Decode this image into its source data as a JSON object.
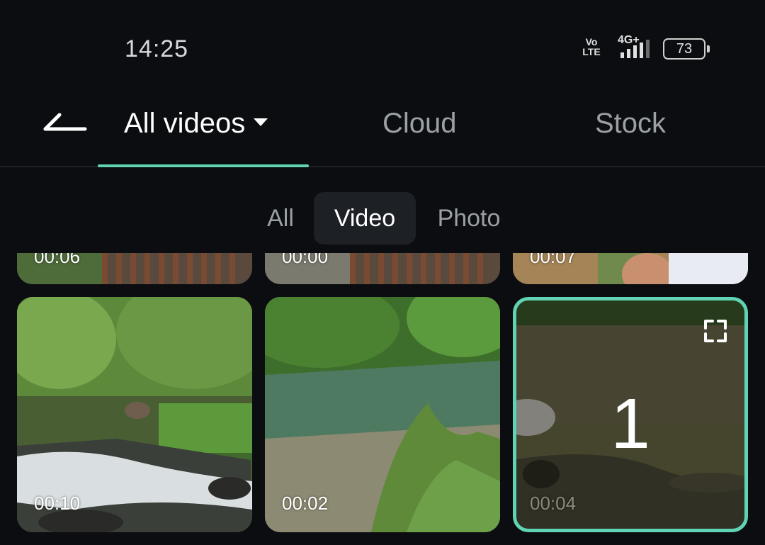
{
  "status_bar": {
    "time": "14:25",
    "volte": "Vo LTE",
    "network": "4G+",
    "battery": "73"
  },
  "tabs": {
    "back_icon": "back-arrow-icon",
    "items": [
      {
        "label": "All videos",
        "active": true,
        "has_dropdown": true
      },
      {
        "label": "Cloud",
        "active": false
      },
      {
        "label": "Stock",
        "active": false
      }
    ],
    "accent_color": "#5fd3b3"
  },
  "filters": {
    "items": [
      {
        "label": "All",
        "active": false
      },
      {
        "label": "Video",
        "active": true
      },
      {
        "label": "Photo",
        "active": false
      }
    ]
  },
  "media": {
    "top_row": [
      {
        "duration": "00:06"
      },
      {
        "duration": "00:00"
      },
      {
        "duration": "00:07"
      }
    ],
    "main_row": [
      {
        "duration": "00:10",
        "selected": false
      },
      {
        "duration": "00:02",
        "selected": false
      },
      {
        "duration": "00:04",
        "selected": true,
        "selection_index": "1"
      }
    ],
    "expand_icon": "expand-icon"
  }
}
